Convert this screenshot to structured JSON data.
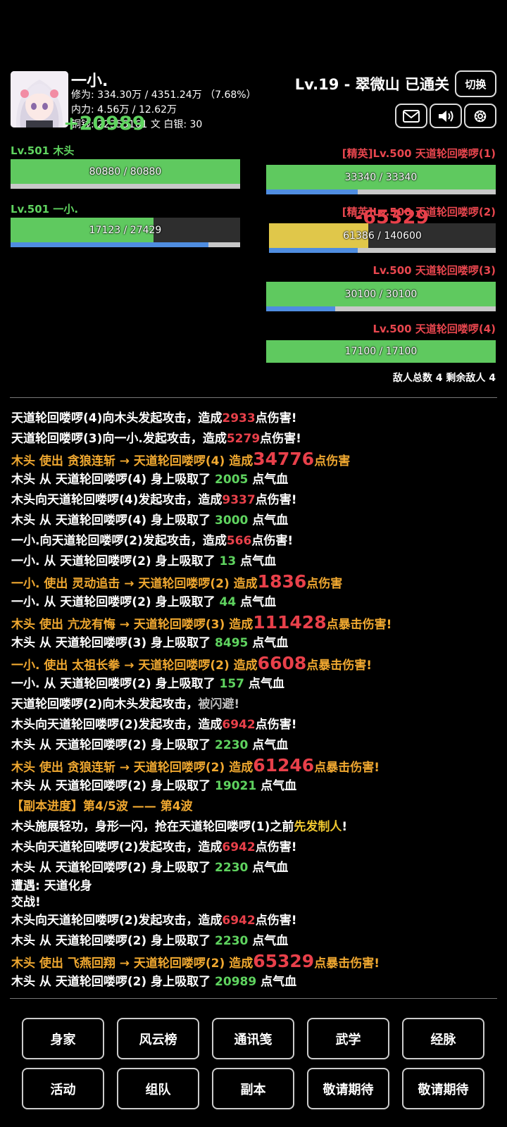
{
  "player": {
    "name": "一小.",
    "cultivation": "修为: 334.30万 / 4351.24万 （7.68%）",
    "inner_power": "内力: 4.56万 / 12.62万",
    "currency": "铜钱: 22355161 文  白银: 30",
    "float_heal": "+20989"
  },
  "stage": {
    "title": "Lv.19 - 翠微山 已通关",
    "switch_label": "切换"
  },
  "icons": {
    "mail": "mail-icon",
    "sound": "speaker-icon",
    "settings": "gear-icon"
  },
  "allies": [
    {
      "label": "Lv.501 木头",
      "hp_text": "80880 / 80880",
      "hp_fraction": 1.0,
      "energy_fraction": 0
    },
    {
      "label": "Lv.501 一小.",
      "hp_text": "17123 / 27429",
      "hp_fraction": 0.624,
      "energy_fraction": 0.863
    }
  ],
  "enemies": [
    {
      "label": "[精英]Lv.500 天道轮回喽啰(1)",
      "hp_text": "33340 / 33340",
      "hp_fraction": 1.0,
      "energy_fraction": 0.4
    },
    {
      "label": "[精英]Lv.500 天道轮回喽啰(2)",
      "hp_text": "61386 / 140600",
      "hp_fraction": 0.437,
      "energy_fraction": 0.39,
      "float_damage": "-65329"
    },
    {
      "label": "Lv.500 天道轮回喽啰(3)",
      "hp_text": "30100 / 30100",
      "hp_fraction": 1.0,
      "energy_fraction": 0.3
    },
    {
      "label": "Lv.500 天道轮回喽啰(4)",
      "hp_text": "17100 / 17100",
      "hp_fraction": 1.0,
      "energy_fraction": null
    }
  ],
  "enemy_count": "敌人总数 4  剩余敌人 4",
  "log": [
    {
      "pre": "天道轮回喽啰(4)向木头发起攻击，造成",
      "dmg": "2933",
      "post": "点伤害!"
    },
    {
      "pre": "天道轮回喽啰(3)向一小.发起攻击，造成",
      "dmg": "5279",
      "post": "点伤害!"
    },
    {
      "pre": "木头 使出 贪狼连斩 → 天道轮回喽啰(4) 造成",
      "dmg": "34776",
      "post": "点伤害"
    },
    {
      "pre": "木头 从 天道轮回喽啰(4) 身上吸取了 ",
      "heal": "2005",
      "post": " 点气血"
    },
    {
      "pre": "木头向天道轮回喽啰(4)发起攻击，造成",
      "dmg": "9337",
      "post": "点伤害!"
    },
    {
      "pre": "木头 从 天道轮回喽啰(4) 身上吸取了 ",
      "heal": "3000",
      "post": " 点气血"
    },
    {
      "pre": "一小.向天道轮回喽啰(2)发起攻击，造成",
      "dmg": "566",
      "post": "点伤害!"
    },
    {
      "pre": "一小. 从 天道轮回喽啰(2) 身上吸取了 ",
      "heal": "13",
      "post": " 点气血"
    },
    {
      "pre": "一小. 使出 灵动追击 → 天道轮回喽啰(2) 造成",
      "dmg": "1836",
      "post": "点伤害"
    },
    {
      "pre": "一小. 从 天道轮回喽啰(2) 身上吸取了 ",
      "heal": "44",
      "post": " 点气血"
    },
    {
      "pre": "木头 使出 亢龙有悔 → 天道轮回喽啰(3) 造成",
      "dmg": "111428",
      "post": "点暴击伤害!"
    },
    {
      "pre": "木头 从 天道轮回喽啰(3) 身上吸取了 ",
      "heal": "8495",
      "post": " 点气血"
    },
    {
      "pre": "一小. 使出 太祖长拳 → 天道轮回喽啰(2) 造成",
      "dmg": "6608",
      "post": "点暴击伤害!"
    },
    {
      "pre": "一小. 从 天道轮回喽啰(2) 身上吸取了 ",
      "heal": "157",
      "post": " 点气血"
    },
    {
      "pre": "天道轮回喽啰(2)向木头发起攻击，",
      "dodge": "被闪避!"
    },
    {
      "pre": "木头向天道轮回喽啰(2)发起攻击，造成",
      "dmg": "6942",
      "post": "点伤害!"
    },
    {
      "pre": "木头 从 天道轮回喽啰(2) 身上吸取了 ",
      "heal": "2230",
      "post": " 点气血"
    },
    {
      "pre": "木头 使出 贪狼连斩 → 天道轮回喽啰(2) 造成",
      "dmg": "61246",
      "post": "点暴击伤害!"
    },
    {
      "pre": "木头 从 天道轮回喽啰(2) 身上吸取了 ",
      "heal": "19021",
      "post": " 点气血"
    },
    {
      "progress": "【副本进度】第4/5波 —— 第4波"
    },
    {
      "pre": "木头施展轻功，身形一闪，抢在天道轮回喽啰(1)之前",
      "first": "先发制人",
      "post": "!"
    },
    {
      "pre": "木头向天道轮回喽啰(2)发起攻击，造成",
      "dmg": "6942",
      "post": "点伤害!"
    },
    {
      "pre": "木头 从 天道轮回喽啰(2) 身上吸取了 ",
      "heal": "2230",
      "post": " 点气血"
    },
    {
      "pre": "遭遇: 天道化身"
    },
    {
      "pre": "交战!"
    },
    {
      "pre": "木头向天道轮回喽啰(2)发起攻击，造成",
      "dmg": "6942",
      "post": "点伤害!"
    },
    {
      "pre": "木头 从 天道轮回喽啰(2) 身上吸取了 ",
      "heal": "2230",
      "post": " 点气血"
    },
    {
      "pre": "木头 使出 飞燕回翔 → 天道轮回喽啰(2) 造成",
      "dmg": "65329",
      "post": "点暴击伤害!"
    },
    {
      "pre": "木头 从 天道轮回喽啰(2) 身上吸取了 ",
      "heal": "20989",
      "post": " 点气血"
    }
  ],
  "menu": {
    "row1": [
      "身家",
      "风云榜",
      "通讯笺",
      "武学",
      "经脉"
    ],
    "row2": [
      "活动",
      "组队",
      "副本",
      "敬请期待",
      "敬请期待"
    ]
  },
  "colors": {
    "hp_green": "#5fc95f",
    "hp_yellow": "#e0c74a",
    "energy_blue": "#4f8de0",
    "damage_red": "#e8404a",
    "heal_green": "#5fd35f",
    "skill_orange": "#f0a830"
  }
}
